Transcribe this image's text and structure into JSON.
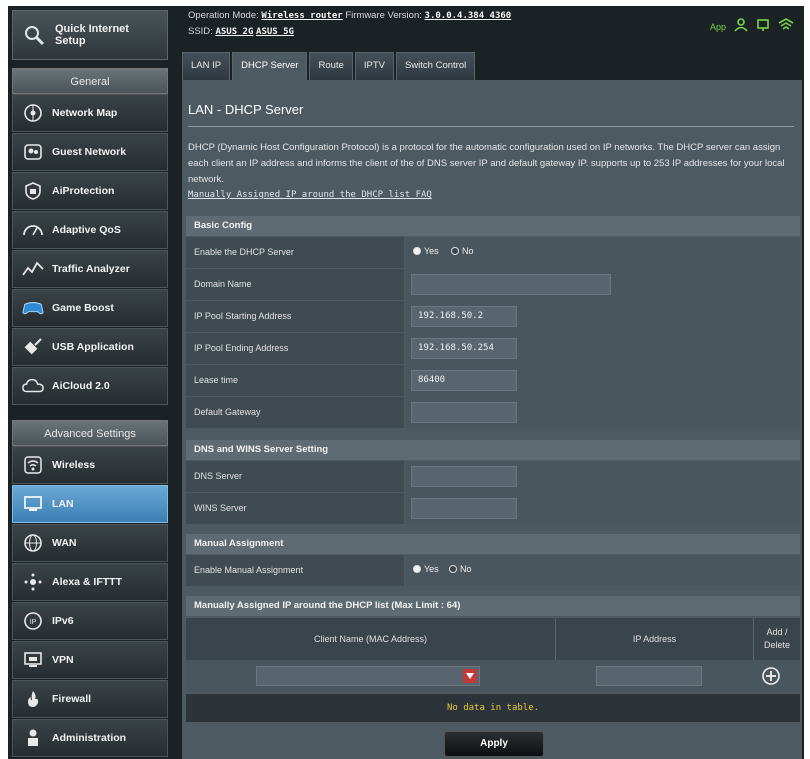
{
  "topbar": {
    "operation_mode_label": "Operation Mode:",
    "operation_mode_value": "Wireless router",
    "firmware_label": "Firmware Version:",
    "firmware_value": "3.0.0.4.384_4360",
    "ssid_label": "SSID:",
    "ssid_1": "ASUS_2G",
    "ssid_2": "ASUS_5G",
    "app_label": "App"
  },
  "sidebar": {
    "quick_setup": "Quick Internet Setup",
    "general_header": "General",
    "general_items": [
      {
        "label": "Network Map",
        "icon": "network-map-icon"
      },
      {
        "label": "Guest Network",
        "icon": "guest-network-icon"
      },
      {
        "label": "AiProtection",
        "icon": "shield-icon"
      },
      {
        "label": "Adaptive QoS",
        "icon": "speedometer-icon"
      },
      {
        "label": "Traffic Analyzer",
        "icon": "traffic-icon"
      },
      {
        "label": "Game Boost",
        "icon": "gamepad-icon"
      },
      {
        "label": "USB Application",
        "icon": "usb-icon"
      },
      {
        "label": "AiCloud 2.0",
        "icon": "cloud-icon"
      }
    ],
    "advanced_header": "Advanced Settings",
    "advanced_items": [
      {
        "label": "Wireless",
        "icon": "wireless-icon"
      },
      {
        "label": "LAN",
        "icon": "lan-icon",
        "active": true
      },
      {
        "label": "WAN",
        "icon": "globe-icon"
      },
      {
        "label": "Alexa & IFTTT",
        "icon": "alexa-icon"
      },
      {
        "label": "IPv6",
        "icon": "ipv6-icon"
      },
      {
        "label": "VPN",
        "icon": "vpn-icon"
      },
      {
        "label": "Firewall",
        "icon": "firewall-icon"
      },
      {
        "label": "Administration",
        "icon": "admin-icon"
      }
    ]
  },
  "tabs": [
    "LAN IP",
    "DHCP Server",
    "Route",
    "IPTV",
    "Switch Control"
  ],
  "active_tab": "DHCP Server",
  "main": {
    "title": "LAN - DHCP Server",
    "description": "DHCP (Dynamic Host Configuration Protocol) is a protocol for the automatic configuration used on IP networks. The DHCP server can assign each client an IP address and informs the client of the of DNS server IP and default gateway IP. supports up to 253 IP addresses for your local network.",
    "faq_link": "Manually Assigned IP around the DHCP list FAQ"
  },
  "basic": {
    "header": "Basic Config",
    "enable_label": "Enable the DHCP Server",
    "yes": "Yes",
    "no": "No",
    "domain_label": "Domain Name",
    "domain_value": "",
    "start_label": "IP Pool Starting Address",
    "start_value": "192.168.50.2",
    "end_label": "IP Pool Ending Address",
    "end_value": "192.168.50.254",
    "lease_label": "Lease time",
    "lease_value": "86400",
    "gateway_label": "Default Gateway",
    "gateway_value": ""
  },
  "dns": {
    "header": "DNS and WINS Server Setting",
    "dns_label": "DNS Server",
    "dns_value": "",
    "wins_label": "WINS Server",
    "wins_value": ""
  },
  "manual": {
    "header": "Manual Assignment",
    "enable_label": "Enable Manual Assignment",
    "yes": "Yes",
    "no": "No"
  },
  "list": {
    "header": "Manually Assigned IP around the DHCP list (Max Limit : 64)",
    "col_client": "Client Name (MAC Address)",
    "col_ip": "IP Address",
    "col_add": "Add / Delete",
    "no_data": "No data in table."
  },
  "apply_label": "Apply",
  "colors": {
    "accent": "#3c7fb3",
    "background": "#1b2226",
    "panel": "#4d5a62",
    "app_green": "#7ad24a",
    "no_data": "#e8c83a"
  }
}
